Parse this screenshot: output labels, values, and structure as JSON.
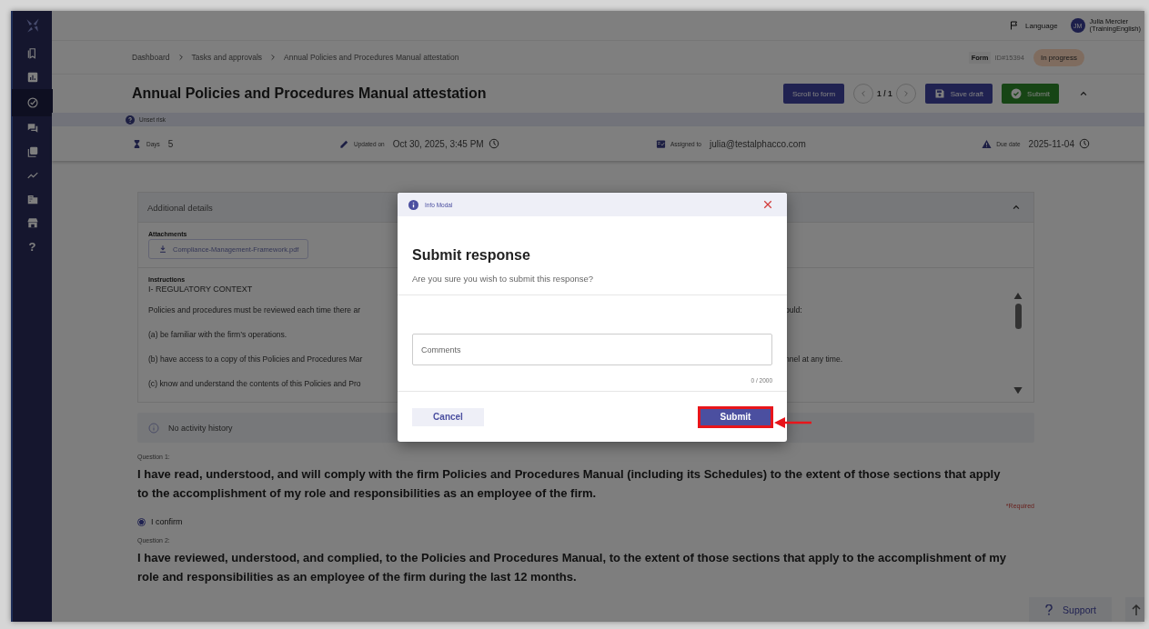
{
  "sidebar": {
    "items": [
      {
        "kind": "documents",
        "selected": false
      },
      {
        "kind": "chart",
        "selected": false
      },
      {
        "kind": "check",
        "selected": true
      },
      {
        "kind": "chat",
        "selected": false
      },
      {
        "kind": "gallery",
        "selected": false
      },
      {
        "kind": "trend",
        "selected": false
      },
      {
        "kind": "building",
        "selected": false
      },
      {
        "kind": "store",
        "selected": false
      },
      {
        "kind": "help",
        "glyph": "?",
        "selected": false
      }
    ]
  },
  "topbar": {
    "language": "Language",
    "user": {
      "initials": "JM",
      "name": "Julia Mercier",
      "org": "(TrainingEnglish)"
    }
  },
  "breadcrumb": [
    "Dashboard",
    "Tasks and approvals",
    "Annual Policies and Procedures Manual attestation"
  ],
  "form": {
    "label": "Form",
    "id": "ID#15394",
    "status": "In progress"
  },
  "title": "Annual Policies and Procedures Manual attestation",
  "actions": {
    "scroll": "Scroll to form",
    "pager": "1 / 1",
    "save": "Save draft",
    "submit": "Submit"
  },
  "risk": "Unset risk",
  "meta": [
    {
      "kind": "days",
      "label": "Days",
      "value": "5"
    },
    {
      "kind": "updated",
      "label": "Updated on",
      "value": "Oct 30, 2025, 3:45 PM"
    },
    {
      "kind": "assigned",
      "label": "Assigned to",
      "value": "julia@testalphacco.com"
    },
    {
      "kind": "due",
      "label": "Due date",
      "value": "2025-11-04"
    }
  ],
  "panel": {
    "title": "Additional details",
    "expanded": true,
    "attachments_label": "Attachments",
    "attachment": "Compliance-Management-Framework.pdf",
    "instructions_label": "Instructions",
    "heading": "I- REGULATORY CONTEXT",
    "lines": [
      {
        "left": "Policies and procedures must be reviewed each time there ar",
        "right": "ould:"
      },
      {
        "left": "(a) be familiar with the firm’s operations."
      },
      {
        "left": "(b) have access to a copy of this Policies and Procedures Mar",
        "right": "nnel at any time."
      },
      {
        "left": "(c) know and understand the contents of this Policies and Pro"
      }
    ]
  },
  "activity": "No activity history",
  "questions": [
    {
      "label": "Question 1:",
      "text": " I have read, understood, and will comply with the firm Policies and Procedures Manual (including its Schedules) to the extent of those sections that apply to the accomplishment of my role and responsibilities as an employee of the firm.",
      "required": "*Required",
      "option": {
        "label": "I confirm",
        "selected": true
      }
    },
    {
      "label": "Question 2:",
      "text": " I have reviewed, understood, and complied, to the Policies and Procedures Manual, to the extent of those sections that apply to the accomplishment of my role and responsibilities as an employee of the firm during the last 12 months."
    }
  ],
  "support": "Support",
  "modal": {
    "header": "Info Modal",
    "title": "Submit response",
    "message": "Are you sure you wish to submit this response?",
    "placeholder": "Comments",
    "counter": "0 / 2000",
    "cancel": "Cancel",
    "submit": {
      "label": "Submit",
      "highlighted": true
    }
  }
}
